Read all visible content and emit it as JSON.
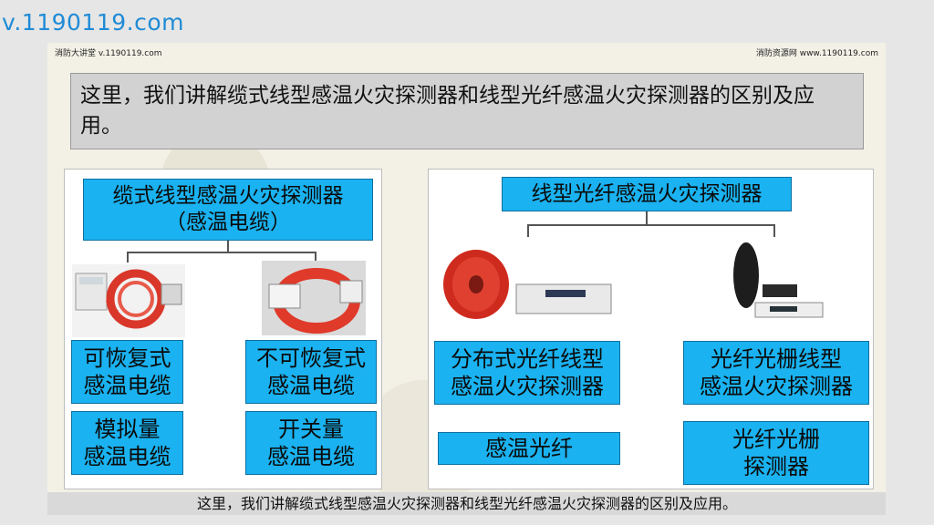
{
  "watermark": "v.1190119.com",
  "header": {
    "left": "消防大讲堂 v.1190119.com",
    "right": "消防资源网 www.1190119.com"
  },
  "title": "这里，我们讲解缆式线型感温火灾探测器和线型光纤感温火灾探测器的区别及应用。",
  "left_panel": {
    "top_box": [
      "缆式线型感温火灾探测器",
      "（感温电缆）"
    ],
    "items": [
      [
        "可恢复式",
        "感温电缆"
      ],
      [
        "不可恢复式",
        "感温电缆"
      ],
      [
        "模拟量",
        "感温电缆"
      ],
      [
        "开关量",
        "感温电缆"
      ]
    ]
  },
  "right_panel": {
    "top_box": "线型光纤感温火灾探测器",
    "items": [
      [
        "分布式光纤线型",
        "感温火灾探测器"
      ],
      [
        "光纤光栅线型",
        "感温火灾探测器"
      ],
      [
        "感温光纤"
      ],
      [
        "光纤光栅",
        "探测器"
      ]
    ]
  },
  "caption": "这里，我们讲解缆式线型感温火灾探测器和线型光纤感温火灾探测器的区别及应用。",
  "colors": {
    "box_fill": "#1ab2f0",
    "watermark": "#1f8bd6"
  }
}
